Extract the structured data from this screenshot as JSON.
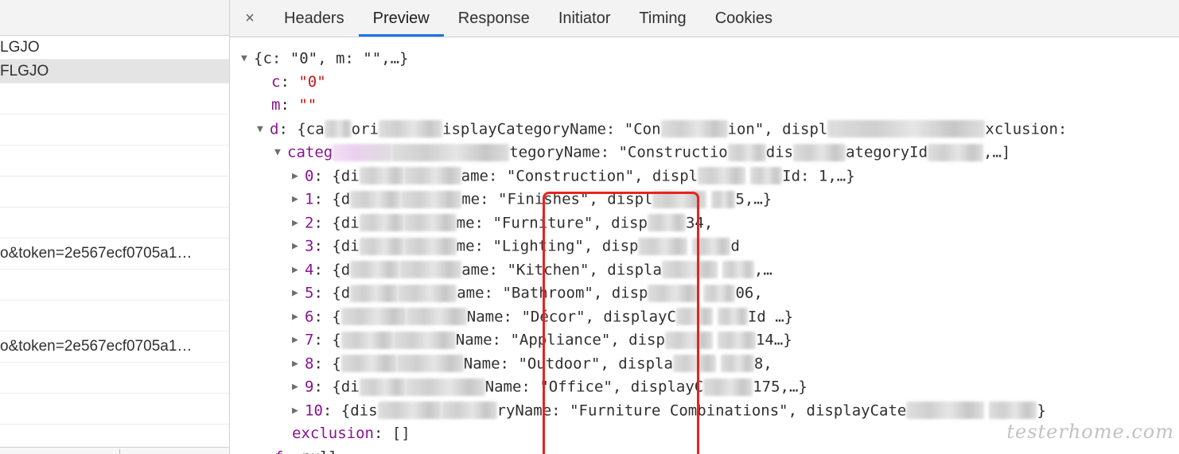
{
  "left_list": {
    "rows": [
      {
        "text": "LGJO",
        "selected": false
      },
      {
        "text": "FLGJO",
        "selected": true
      },
      {
        "text": "",
        "selected": false
      },
      {
        "text": "",
        "selected": false
      },
      {
        "text": "",
        "selected": false
      },
      {
        "text": "",
        "selected": false
      },
      {
        "text": "",
        "selected": false
      },
      {
        "text": "o&token=2e567ecf0705a1…",
        "selected": false
      },
      {
        "text": "",
        "selected": false
      },
      {
        "text": "",
        "selected": false
      },
      {
        "text": "o&token=2e567ecf0705a1…",
        "selected": false
      },
      {
        "text": "",
        "selected": false
      },
      {
        "text": "",
        "selected": false
      },
      {
        "text": "",
        "selected": false
      }
    ]
  },
  "tabs": {
    "close_glyph": "×",
    "items": [
      "Headers",
      "Preview",
      "Response",
      "Initiator",
      "Timing",
      "Cookies"
    ],
    "active": "Preview",
    "active_color": "#1a73e8"
  },
  "preview": {
    "root_summary": "{c: \"0\", m: \"\",…}",
    "c_key": "c",
    "c_value": "\"0\"",
    "m_key": "m",
    "m_value": "\"\"",
    "d_key": "d",
    "d_line_a": "{ca",
    "d_line_b": "ori",
    "d_line_c": "isplayCategoryName: \"Con",
    "d_line_d": "ion\", displ",
    "d_line_e": "xclusion:",
    "cat_key": "categ",
    "cat_line_b": "tegoryName: \"Constructio",
    "cat_line_c": "dis",
    "cat_line_d": "ategoryId",
    "cat_line_e": ",…]",
    "items": [
      {
        "index": "0",
        "pre": "{di",
        "mid": "ame:",
        "name": "\"Construction\"",
        "post": ", displ",
        "tail": "Id: 1,…}"
      },
      {
        "index": "1",
        "pre": "{d",
        "mid": "me:",
        "name": "\"Finishes\"",
        "post": ", displ",
        "tail": "5,…}"
      },
      {
        "index": "2",
        "pre": "{di",
        "mid": "me:",
        "name": "\"Furniture\"",
        "post": ", disp",
        "tail": "34,"
      },
      {
        "index": "3",
        "pre": "{di",
        "mid": "me:",
        "name": "\"Lighting\"",
        "post": ", disp",
        "tail": "d"
      },
      {
        "index": "4",
        "pre": "{d",
        "mid": "ame:",
        "name": "\"Kitchen\"",
        "post": ", displa",
        "tail": ",…"
      },
      {
        "index": "5",
        "pre": "{d",
        "mid": "ame:",
        "name": "\"Bathroom\"",
        "post": ", disp",
        "tail": "06,"
      },
      {
        "index": "6",
        "pre": "{",
        "mid": "Name:",
        "name": "\"Décor\"",
        "post": ", displayC",
        "tail": "Id …}"
      },
      {
        "index": "7",
        "pre": "{",
        "mid": "Name:",
        "name": "\"Appliance\"",
        "post": ", disp",
        "tail": "14…}"
      },
      {
        "index": "8",
        "pre": "{",
        "mid": "Name:",
        "name": "\"Outdoor\"",
        "post": ", displa",
        "tail": "8,"
      },
      {
        "index": "9",
        "pre": "{di",
        "mid": "Name:",
        "name": "\"Office\"",
        "post": ", displayC",
        "tail": "175,…}"
      },
      {
        "index": "10",
        "pre": "{dis",
        "mid": "ryName:",
        "name": "\"Furniture Combinations\"",
        "post": ", displayCate",
        "tail": "}"
      }
    ],
    "exclusion_key": "exclusion",
    "exclusion_value": "[]",
    "f_key": "f",
    "f_value": "null"
  },
  "highlight_color": "#e8231f",
  "watermark": "testerhome.com"
}
